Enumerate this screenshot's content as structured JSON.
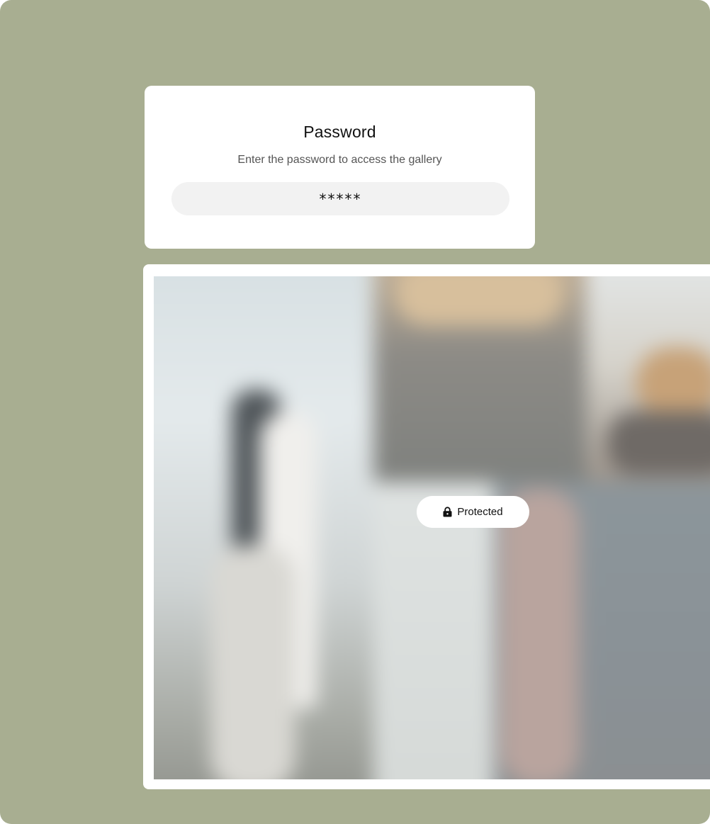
{
  "password_card": {
    "title": "Password",
    "subtitle": "Enter the password to access the gallery",
    "input_value": "*****"
  },
  "gallery": {
    "badge_icon": "lock-icon",
    "badge_label": "Protected"
  },
  "colors": {
    "background": "#a8ae91",
    "card": "#ffffff",
    "input_fill": "#f2f2f2"
  }
}
